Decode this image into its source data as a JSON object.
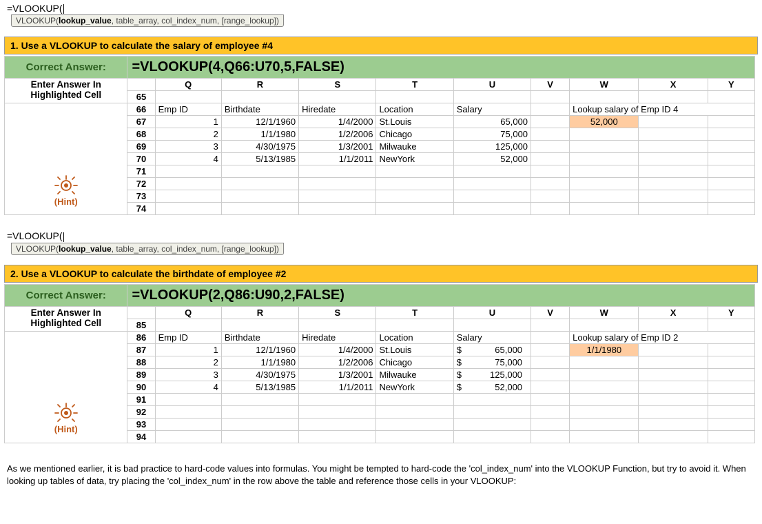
{
  "formula_typed": "=VLOOKUP(",
  "tooltip": {
    "fn": "VLOOKUP",
    "sig_bold": "lookup_value",
    "sig_rest": ", table_array, col_index_num, [range_lookup])"
  },
  "q1": {
    "bar": "1. Use a VLOOKUP to calculate the salary of employee #4",
    "correct_label": "Correct Answer:",
    "correct_formula": "=VLOOKUP(4,Q66:U70,5,FALSE)",
    "instr_l1": "Enter Answer In",
    "instr_l2": "Highlighted Cell",
    "hint_label": "(Hint)",
    "cols": [
      "Q",
      "R",
      "S",
      "T",
      "U",
      "V",
      "W",
      "X",
      "Y"
    ],
    "rows": [
      "65",
      "66",
      "67",
      "68",
      "69",
      "70",
      "71",
      "72",
      "73",
      "74"
    ],
    "headers": {
      "q": "Emp ID",
      "r": "Birthdate",
      "s": "Hiredate",
      "t": "Location",
      "u": "Salary"
    },
    "lookup_label_a": "Lookup salary of Emp ID 4",
    "lookup_value": "52,000",
    "data": [
      {
        "id": "1",
        "bd": "12/1/1960",
        "hd": "1/4/2000",
        "loc": "St.Louis",
        "sal": "65,000"
      },
      {
        "id": "2",
        "bd": "1/1/1980",
        "hd": "1/2/2006",
        "loc": "Chicago",
        "sal": "75,000"
      },
      {
        "id": "3",
        "bd": "4/30/1975",
        "hd": "1/3/2001",
        "loc": "Milwauke",
        "sal": "125,000"
      },
      {
        "id": "4",
        "bd": "5/13/1985",
        "hd": "1/1/2011",
        "loc": "NewYork",
        "sal": "52,000"
      }
    ]
  },
  "q2": {
    "bar": "2. Use a VLOOKUP to calculate the birthdate of employee #2",
    "correct_label": "Correct Answer:",
    "correct_formula": "=VLOOKUP(2,Q86:U90,2,FALSE)",
    "instr_l1": "Enter Answer In",
    "instr_l2": "Highlighted Cell",
    "hint_label": "(Hint)",
    "cols": [
      "Q",
      "R",
      "S",
      "T",
      "U",
      "V",
      "W",
      "X",
      "Y"
    ],
    "rows": [
      "85",
      "86",
      "87",
      "88",
      "89",
      "90",
      "91",
      "92",
      "93",
      "94"
    ],
    "headers": {
      "q": "Emp ID",
      "r": "Birthdate",
      "s": "Hiredate",
      "t": "Location",
      "u": "Salary"
    },
    "lookup_label_a": "Lookup salary of Emp ID 2",
    "lookup_value": "1/1/1980",
    "data": [
      {
        "id": "1",
        "bd": "12/1/1960",
        "hd": "1/4/2000",
        "loc": "St.Louis",
        "sal_sym": "$",
        "sal": "65,000"
      },
      {
        "id": "2",
        "bd": "1/1/1980",
        "hd": "1/2/2006",
        "loc": "Chicago",
        "sal_sym": "$",
        "sal": "75,000"
      },
      {
        "id": "3",
        "bd": "4/30/1975",
        "hd": "1/3/2001",
        "loc": "Milwauke",
        "sal_sym": "$",
        "sal": "125,000"
      },
      {
        "id": "4",
        "bd": "5/13/1985",
        "hd": "1/1/2011",
        "loc": "NewYork",
        "sal_sym": "$",
        "sal": "52,000"
      }
    ]
  },
  "footer_text": "As we mentioned earlier, it is bad practice to hard-code values into formulas. You might be tempted to hard-code the 'col_index_num' into the VLOOKUP Function, but try to avoid it. When looking up tables of data, try placing the 'col_index_num' in the row above the table and reference those cells in your VLOOKUP:"
}
